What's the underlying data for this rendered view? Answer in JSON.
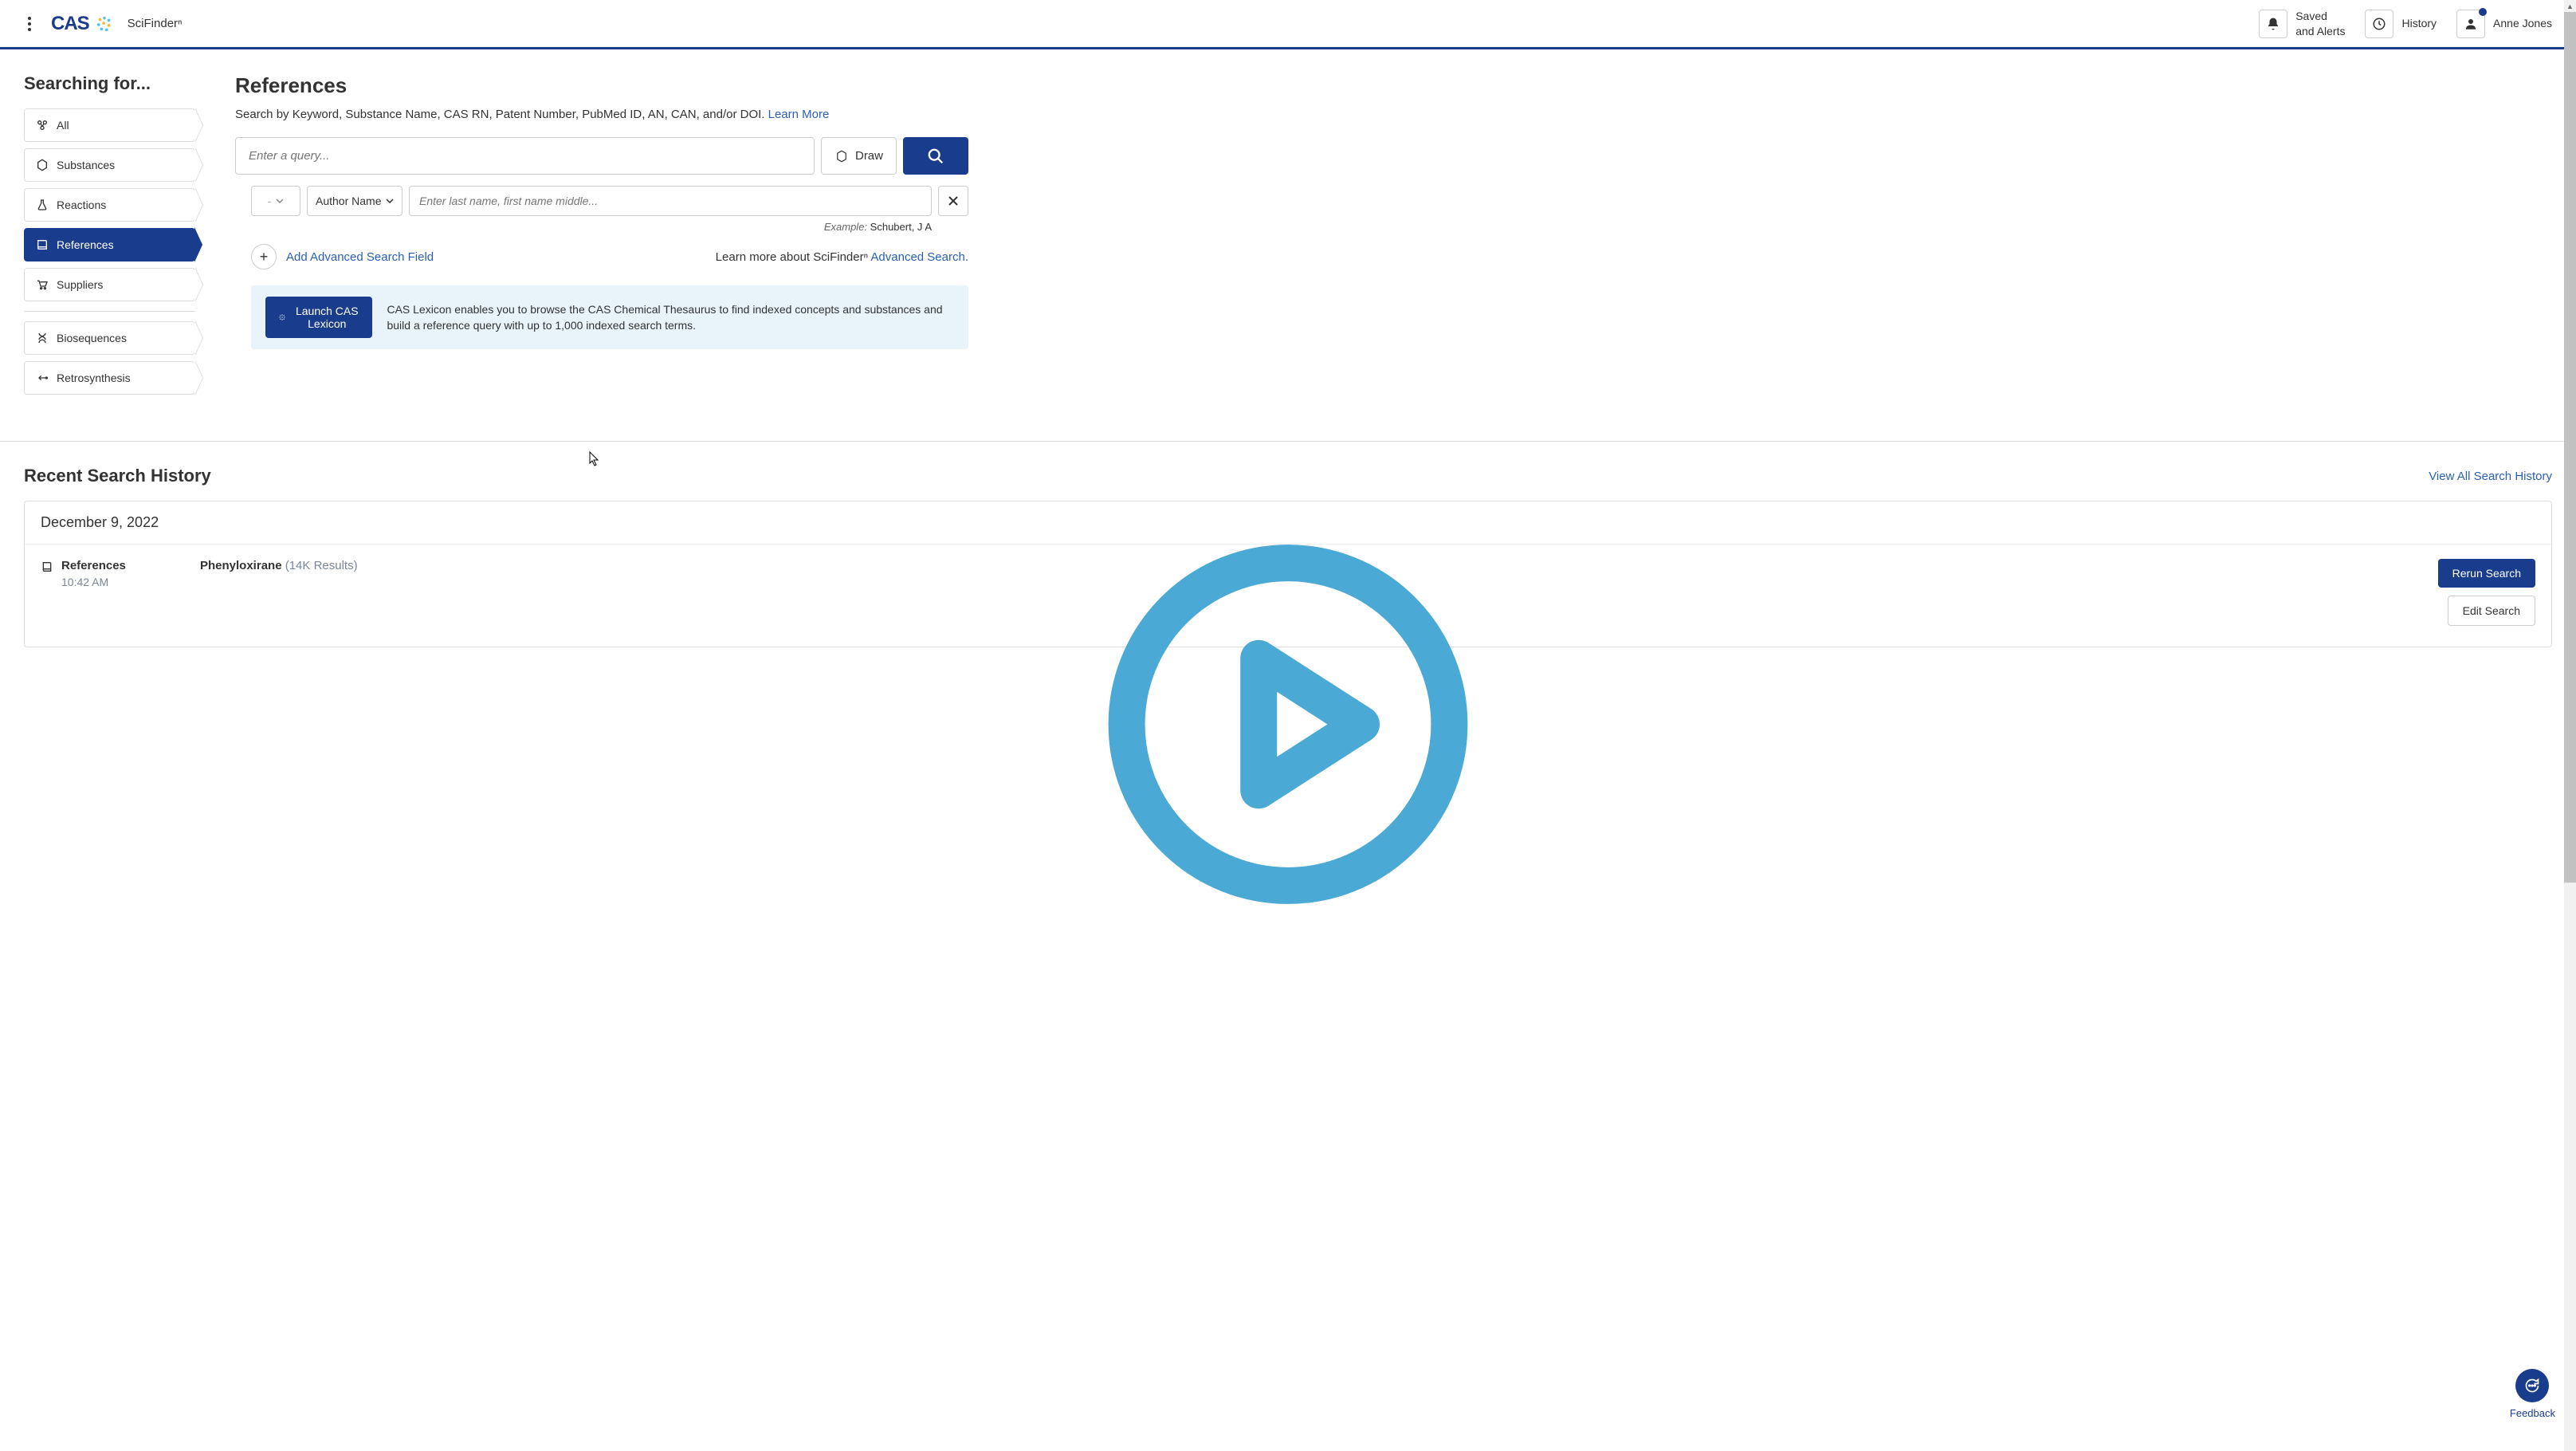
{
  "header": {
    "logo_text": "CAS",
    "app_name": "SciFinderⁿ",
    "saved_alerts": "Saved\nand Alerts",
    "history": "History",
    "user_name": "Anne Jones"
  },
  "sidebar": {
    "title": "Searching for...",
    "items": [
      {
        "label": "All",
        "active": false
      },
      {
        "label": "Substances",
        "active": false
      },
      {
        "label": "Reactions",
        "active": false
      },
      {
        "label": "References",
        "active": true
      },
      {
        "label": "Suppliers",
        "active": false
      }
    ],
    "items2": [
      {
        "label": "Biosequences"
      },
      {
        "label": "Retrosynthesis"
      }
    ]
  },
  "main": {
    "title": "References",
    "subtitle_pre": "Search by Keyword, Substance Name, CAS RN, Patent Number, PubMed ID, AN, CAN, and/or DOI. ",
    "learn_more": "Learn More",
    "search_placeholder": "Enter a query...",
    "draw_label": "Draw",
    "adv": {
      "operator": "-",
      "field": "Author Name",
      "placeholder": "Enter last name, first name middle...",
      "example_label": "Example:",
      "example_value": "Schubert, J A"
    },
    "add_field": "Add Advanced Search Field",
    "learn_adv_pre": "Learn more about SciFinderⁿ ",
    "learn_adv_link": "Advanced Search.",
    "lexicon": {
      "button": "Launch CAS Lexicon",
      "text": "CAS Lexicon enables you to browse the CAS Chemical Thesaurus to find indexed concepts and substances and build a reference query with up to 1,000 indexed search terms."
    }
  },
  "history": {
    "title": "Recent Search History",
    "view_all": "View All Search History",
    "date": "December 9, 2022",
    "item": {
      "type": "References",
      "time": "10:42 AM",
      "query": "Phenyloxirane",
      "count": "(14K Results)",
      "rerun": "Rerun Search",
      "edit": "Edit Search"
    }
  },
  "feedback": {
    "label": "Feedback"
  }
}
